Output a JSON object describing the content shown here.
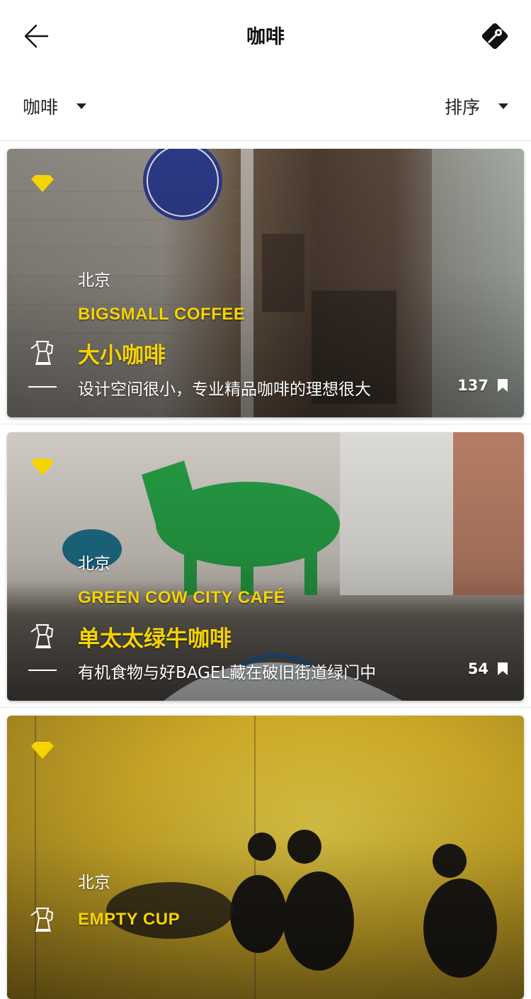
{
  "header": {
    "title": "咖啡",
    "back_icon": "arrow-left-icon",
    "map_icon": "map-pin-icon"
  },
  "filters": {
    "category": "咖啡",
    "sort": "排序"
  },
  "colors": {
    "accent": "#f5d400"
  },
  "cards": [
    {
      "city": "北京",
      "name_en": "BIGSMALL COFFEE",
      "name_cn": "大小咖啡",
      "desc": "设计空间很小，专业精品咖啡的理想很大",
      "count": "137"
    },
    {
      "city": "北京",
      "name_en": "GREEN COW CITY CAFÉ",
      "name_cn": "单太太绿牛咖啡",
      "desc": "有机食物与好BAGEL藏在破旧街道绿门中",
      "count": "54"
    },
    {
      "city": "北京",
      "name_en": "EMPTY CUP",
      "name_cn": "",
      "desc": "",
      "count": ""
    }
  ]
}
